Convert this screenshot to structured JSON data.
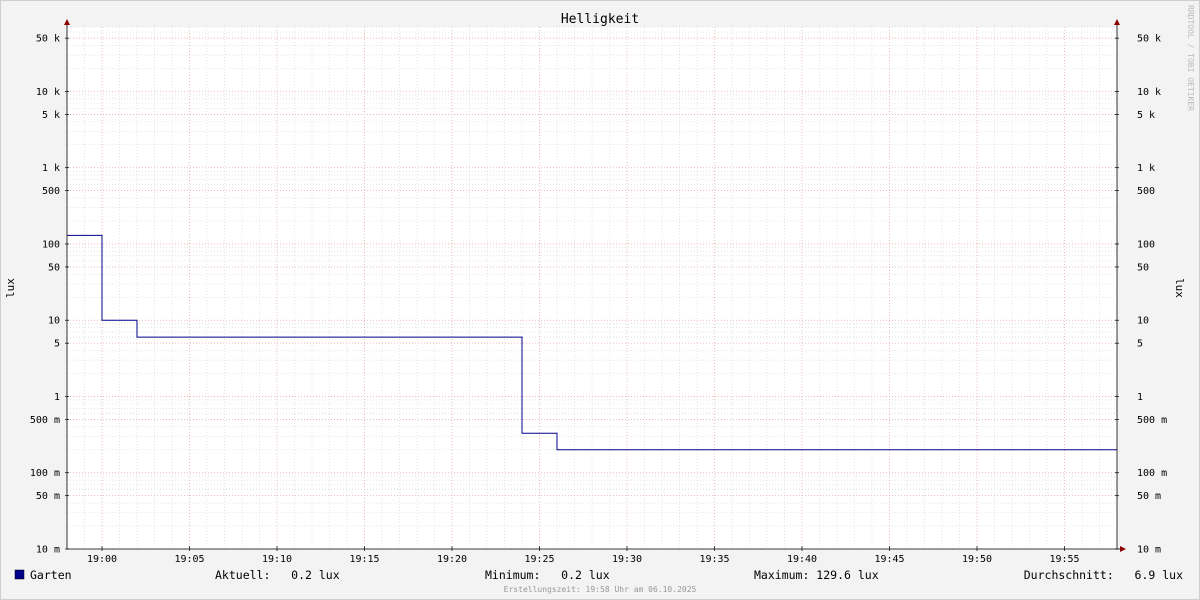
{
  "chart_data": {
    "type": "line",
    "title": "Helligkeit",
    "ylabel": "lux",
    "y_scale": "log",
    "ylim": [
      0.01,
      70000
    ],
    "xlim": [
      "18:58",
      "19:58"
    ],
    "grid": true,
    "x_ticks": [
      "19:00",
      "19:05",
      "19:10",
      "19:15",
      "19:20",
      "19:25",
      "19:30",
      "19:35",
      "19:40",
      "19:45",
      "19:50",
      "19:55"
    ],
    "y_ticks": [
      {
        "value": 50000,
        "label": "50 k"
      },
      {
        "value": 10000,
        "label": "10 k"
      },
      {
        "value": 5000,
        "label": "5 k"
      },
      {
        "value": 1000,
        "label": "1 k"
      },
      {
        "value": 500,
        "label": "500"
      },
      {
        "value": 100,
        "label": "100"
      },
      {
        "value": 50,
        "label": "50"
      },
      {
        "value": 10,
        "label": "10"
      },
      {
        "value": 5,
        "label": "5"
      },
      {
        "value": 1,
        "label": "1"
      },
      {
        "value": 0.5,
        "label": "500 m"
      },
      {
        "value": 0.1,
        "label": "100 m"
      },
      {
        "value": 0.05,
        "label": "50 m"
      },
      {
        "value": 0.01,
        "label": "10 m"
      }
    ],
    "series": [
      {
        "name": "Garten",
        "color": "#00008b",
        "points": [
          {
            "x": "18:58",
            "y": 129.6
          },
          {
            "x": "19:00",
            "y": 129.6
          },
          {
            "x": "19:00",
            "y": 10
          },
          {
            "x": "19:02",
            "y": 10
          },
          {
            "x": "19:02",
            "y": 6
          },
          {
            "x": "19:24",
            "y": 6
          },
          {
            "x": "19:24",
            "y": 0.33
          },
          {
            "x": "19:26",
            "y": 0.33
          },
          {
            "x": "19:26",
            "y": 0.2
          },
          {
            "x": "19:58",
            "y": 0.2
          }
        ]
      }
    ]
  },
  "legend": {
    "series_name": "Garten",
    "aktuell": "Aktuell:   0.2 lux",
    "minimum": "Minimum:   0.2 lux",
    "maximum": "Maximum: 129.6 lux",
    "durchschnitt": "Durchschnitt:   6.9 lux"
  },
  "footer": "Erstellungszeit: 19:58 Uhr am 06.10.2025",
  "watermark": "RRDTOOL / TOBI OETIKER",
  "colors": {
    "background": "#f3f3f3",
    "canvas": "#ffffff",
    "line": "#00008b",
    "major_grid": "#e8a0a0",
    "minor_grid": "#d4d4d4",
    "arrow": "#8b0000"
  }
}
